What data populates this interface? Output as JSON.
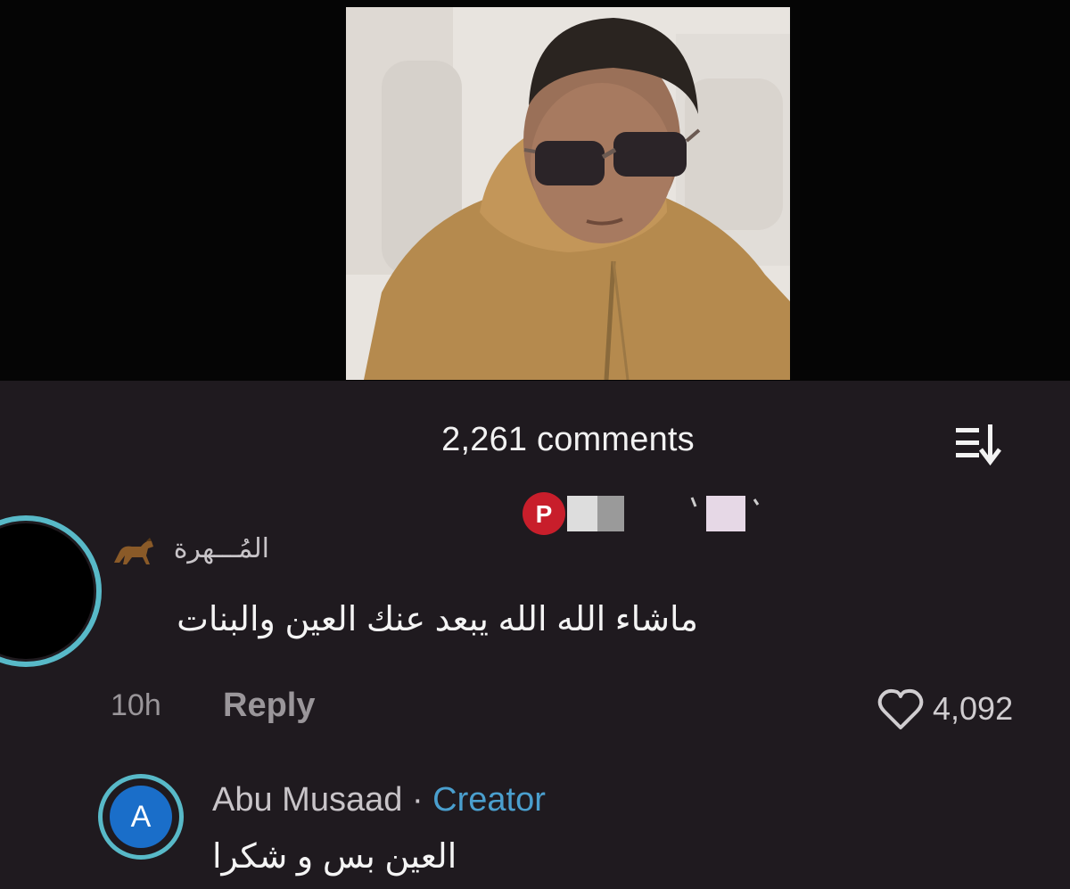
{
  "header": {
    "comments_count": "2,261 comments",
    "sort_icon": "sort-filter-icon"
  },
  "video": {
    "thumbnail": "video-thumbnail"
  },
  "comments": [
    {
      "username": "المُـــهرة",
      "badge_icon": "horse-icon",
      "text": "ماشاء الله الله يبعد عنك العين والبنات",
      "time": "10h",
      "reply_label": "Reply",
      "likes": "4,092",
      "avatar": "avatar-black"
    },
    {
      "avatar_letter": "A",
      "username": "Abu Musaad",
      "separator": "·",
      "role": "Creator",
      "text": "العين بس و شكرا"
    }
  ],
  "colors": {
    "background": "#1f1a1f",
    "accent_ring": "#58b9c8",
    "creator": "#4a9fce",
    "avatar_blue": "#1a6ec9"
  }
}
